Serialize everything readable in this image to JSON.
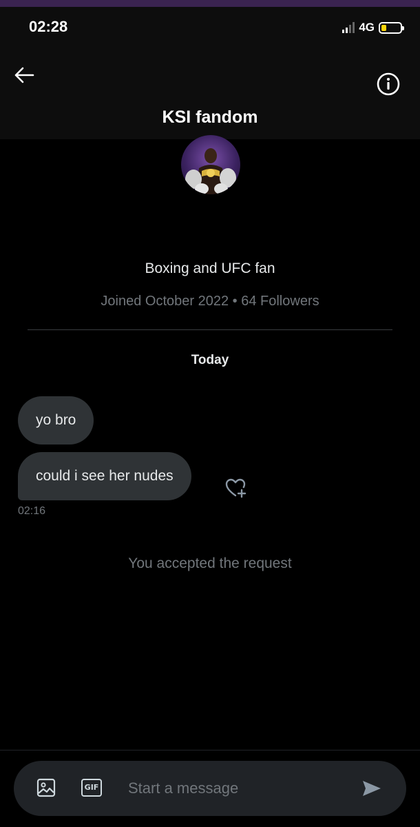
{
  "status_bar": {
    "time": "02:28",
    "network": "4G",
    "battery_level": 0.25
  },
  "header": {
    "title": "KSI fandom"
  },
  "profile": {
    "bio": "Boxing and UFC fan",
    "joined": "Joined October 2022",
    "separator": "•",
    "followers": "64 Followers"
  },
  "conversation": {
    "day_label": "Today",
    "messages": [
      {
        "text": "yo bro"
      },
      {
        "text": "could i see her nudes"
      }
    ],
    "last_time": "02:16",
    "system_note": "You accepted the request"
  },
  "composer": {
    "placeholder": "Start a message",
    "gif_label": "GIF"
  },
  "icons": {
    "back": "arrow-left-icon",
    "info": "info-icon",
    "react": "heart-add-icon",
    "image": "image-icon",
    "send": "send-icon"
  },
  "colors": {
    "background": "#000000",
    "bubble": "#2f3336",
    "muted": "#71767b",
    "text": "#e7e9ea"
  }
}
